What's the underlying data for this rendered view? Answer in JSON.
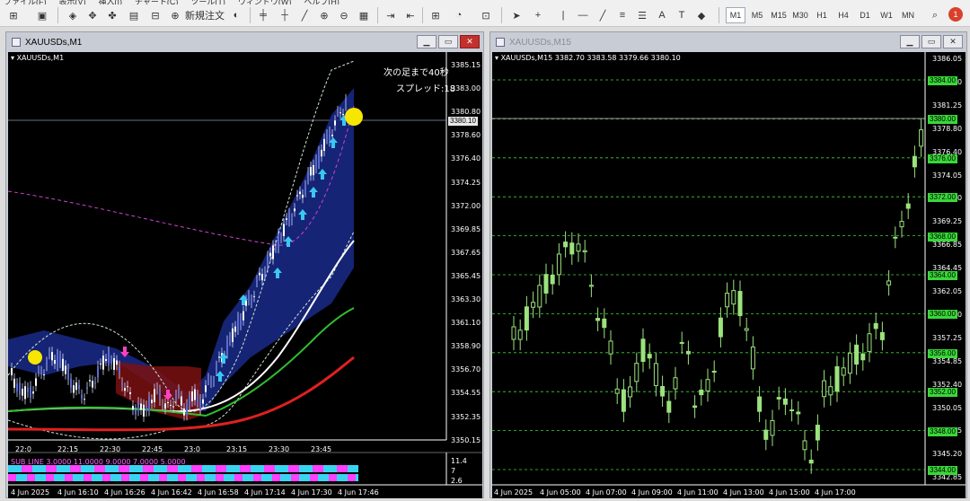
{
  "toolbar": {
    "menu_items": [
      "ファイル(F)",
      "表示(V)",
      "挿入(I)",
      "チャート(C)",
      "ツール(T)",
      "ウィンドウ(W)",
      "ヘルプ(H)"
    ],
    "new_order_label": "新規注文",
    "timeframes": [
      "M1",
      "M5",
      "M15",
      "M30",
      "H1",
      "H4",
      "D1",
      "W1",
      "MN"
    ],
    "active_timeframe": "M1",
    "notification_count": "1"
  },
  "left_window": {
    "title": "XAUUSDs,M1",
    "symbol_label": "XAUUSDs,M1",
    "countdown_text": "次の足まで40秒",
    "spread_text": "スプレッド:18",
    "price_axis": [
      "3385.15",
      "3383.00",
      "3380.80",
      "3378.60",
      "3376.40",
      "3374.25",
      "3372.00",
      "3369.85",
      "3367.65",
      "3365.45",
      "3363.30",
      "3361.10",
      "3358.90",
      "3356.70",
      "3354.55",
      "3352.35",
      "3350.15"
    ],
    "current_price": "3380.10",
    "upper_time_axis": [
      "22:0",
      "22:15",
      "22:30",
      "22:45",
      "23:0",
      "23:15",
      "23:30",
      "23:45"
    ],
    "sub_window_label": "SUB LINE 3.0000 11.0000 9.0000 7.0000 5.0000",
    "sub_axis": [
      "11.4",
      "7",
      "2.6"
    ],
    "bottom_time_axis": [
      "4 Jun 2025",
      "4 Jun 16:10",
      "4 Jun 16:26",
      "4 Jun 16:42",
      "4 Jun 16:58",
      "4 Jun 17:14",
      "4 Jun 17:30",
      "4 Jun 17:46"
    ]
  },
  "right_window": {
    "title": "XAUUSDs,M15",
    "symbol_label": "XAUUSDs,M15  3382.70 3383.58 3379.66 3380.10",
    "price_axis": [
      "3386.05",
      "3383.70",
      "3381.25",
      "3378.80",
      "3376.40",
      "3374.05",
      "3371.60",
      "3369.25",
      "3366.85",
      "3364.45",
      "3362.05",
      "3359.60",
      "3357.25",
      "3354.85",
      "3352.40",
      "3350.05",
      "3347.65",
      "3345.20",
      "3342.85"
    ],
    "green_levels": [
      "3384.00",
      "3380.00",
      "3376.00",
      "3372.00",
      "3368.00",
      "3364.00",
      "3360.00",
      "3356.00",
      "3352.00",
      "3348.00",
      "3344.00"
    ],
    "current_price": "3380.10",
    "time_axis": [
      "4 Jun 2025",
      "4 Jun 05:00",
      "4 Jun 07:00",
      "4 Jun 09:00",
      "4 Jun 11:00",
      "4 Jun 13:00",
      "4 Jun 15:00",
      "4 Jun 17:00"
    ]
  },
  "colors": {
    "bull_candle": "#9be37d",
    "ma_white": "#ffffff",
    "ma_green": "#2fbf2f",
    "ma_red": "#e02020",
    "band_fill": "#1a2a8a",
    "arrow": "#39c8f0",
    "level_line": "#39d739"
  }
}
